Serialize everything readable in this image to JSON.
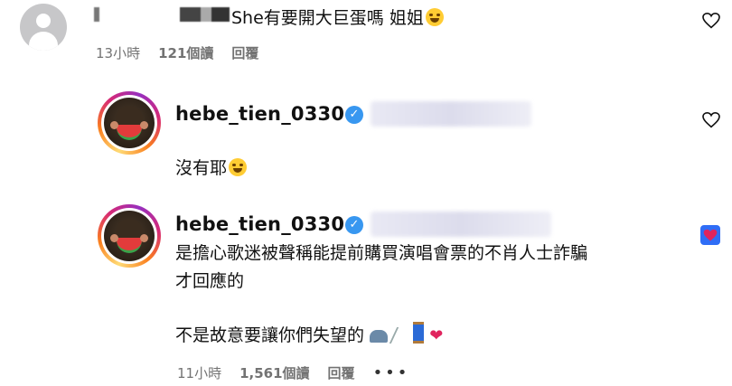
{
  "comment": {
    "text": "She有要開大巨蛋嗎 姐姐",
    "time": "13小時",
    "reads": "121個讀",
    "reply": "回覆"
  },
  "replies": [
    {
      "handle": "hebe_tien_0330",
      "text_lines": [
        "沒有耶"
      ]
    },
    {
      "handle": "hebe_tien_0330",
      "text_lines": [
        "是擔心歌迷被聲稱能提前購買演唱會票的不肖人士詐騙",
        "才回應的",
        "",
        "不是故意要讓你們失望的"
      ],
      "time": "11小時",
      "reads": "1,561個讀",
      "reply": "回覆",
      "more": "•••"
    }
  ],
  "colors": {
    "meta_gray": "#737373",
    "verified_blue": "#3897f0",
    "liked_blue": "#2f6df6"
  },
  "icons": [
    "heart-outline-icon",
    "verified-badge-icon",
    "heart-filled-icon",
    "more-options-icon",
    "grin-sweat-emoji",
    "joy-emoji"
  ]
}
